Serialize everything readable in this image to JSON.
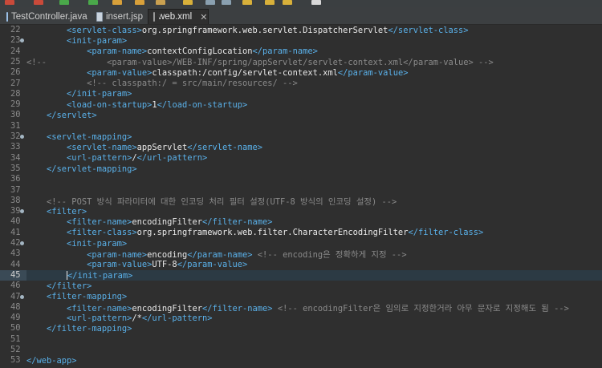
{
  "toolbar": {
    "label": "Eclipse toolbar"
  },
  "tabs": [
    {
      "label": "TestController.java",
      "type": "java"
    },
    {
      "label": "insert.jsp",
      "type": "jsp"
    },
    {
      "label": "web.xml",
      "type": "xml",
      "active": true,
      "close": "✕"
    }
  ],
  "editor": {
    "current_line": 45,
    "lines": [
      {
        "n": "22",
        "fold": false,
        "segs": [
          [
            "x",
            "        "
          ],
          [
            "t",
            "<servlet-class>"
          ],
          [
            "x",
            "org.springframework.web.servlet.DispatcherServlet"
          ],
          [
            "t",
            "</servlet-class>"
          ]
        ]
      },
      {
        "n": "23",
        "fold": true,
        "segs": [
          [
            "x",
            "        "
          ],
          [
            "t",
            "<init-param>"
          ]
        ]
      },
      {
        "n": "24",
        "fold": false,
        "segs": [
          [
            "x",
            "            "
          ],
          [
            "t",
            "<param-name>"
          ],
          [
            "x",
            "contextConfigLocation"
          ],
          [
            "t",
            "</param-name>"
          ]
        ]
      },
      {
        "n": "25",
        "fold": false,
        "segs": [
          [
            "c",
            "<!--            <param-value>/WEB-INF/spring/appServlet/servlet-context.xml</param-value> -->"
          ]
        ]
      },
      {
        "n": "26",
        "fold": false,
        "segs": [
          [
            "x",
            "            "
          ],
          [
            "t",
            "<param-value>"
          ],
          [
            "x",
            "classpath:/config/servlet-context.xml"
          ],
          [
            "t",
            "</param-value>"
          ]
        ]
      },
      {
        "n": "27",
        "fold": false,
        "segs": [
          [
            "x",
            "            "
          ],
          [
            "c",
            "<!-- classpath:/ = src/main/resources/ -->"
          ]
        ]
      },
      {
        "n": "28",
        "fold": false,
        "segs": [
          [
            "x",
            "        "
          ],
          [
            "t",
            "</init-param>"
          ]
        ]
      },
      {
        "n": "29",
        "fold": false,
        "segs": [
          [
            "x",
            "        "
          ],
          [
            "t",
            "<load-on-startup>"
          ],
          [
            "x",
            "1"
          ],
          [
            "t",
            "</load-on-startup>"
          ]
        ]
      },
      {
        "n": "30",
        "fold": false,
        "segs": [
          [
            "x",
            "    "
          ],
          [
            "t",
            "</servlet>"
          ]
        ]
      },
      {
        "n": "31",
        "fold": false,
        "segs": []
      },
      {
        "n": "32",
        "fold": true,
        "segs": [
          [
            "x",
            "    "
          ],
          [
            "t",
            "<servlet-mapping>"
          ]
        ]
      },
      {
        "n": "33",
        "fold": false,
        "segs": [
          [
            "x",
            "        "
          ],
          [
            "t",
            "<servlet-name>"
          ],
          [
            "x",
            "appServlet"
          ],
          [
            "t",
            "</servlet-name>"
          ]
        ]
      },
      {
        "n": "34",
        "fold": false,
        "segs": [
          [
            "x",
            "        "
          ],
          [
            "t",
            "<url-pattern>"
          ],
          [
            "x",
            "/"
          ],
          [
            "t",
            "</url-pattern>"
          ]
        ]
      },
      {
        "n": "35",
        "fold": false,
        "segs": [
          [
            "x",
            "    "
          ],
          [
            "t",
            "</servlet-mapping>"
          ]
        ]
      },
      {
        "n": "36",
        "fold": false,
        "segs": []
      },
      {
        "n": "37",
        "fold": false,
        "segs": []
      },
      {
        "n": "38",
        "fold": false,
        "segs": [
          [
            "x",
            "    "
          ],
          [
            "c",
            "<!-- POST 방식 파라미터에 대한 인코딩 처리 필터 설정(UTF-8 방식의 인코딩 설정) -->"
          ]
        ]
      },
      {
        "n": "39",
        "fold": true,
        "segs": [
          [
            "x",
            "    "
          ],
          [
            "t",
            "<filter>"
          ]
        ]
      },
      {
        "n": "40",
        "fold": false,
        "segs": [
          [
            "x",
            "        "
          ],
          [
            "t",
            "<filter-name>"
          ],
          [
            "x",
            "encodingFilter"
          ],
          [
            "t",
            "</filter-name>"
          ]
        ]
      },
      {
        "n": "41",
        "fold": false,
        "segs": [
          [
            "x",
            "        "
          ],
          [
            "t",
            "<filter-class>"
          ],
          [
            "x",
            "org.springframework.web.filter.CharacterEncodingFilter"
          ],
          [
            "t",
            "</filter-class>"
          ]
        ]
      },
      {
        "n": "42",
        "fold": true,
        "segs": [
          [
            "x",
            "        "
          ],
          [
            "t",
            "<init-param>"
          ]
        ]
      },
      {
        "n": "43",
        "fold": false,
        "segs": [
          [
            "x",
            "            "
          ],
          [
            "t",
            "<param-name>"
          ],
          [
            "x",
            "encoding"
          ],
          [
            "t",
            "</param-name>"
          ],
          [
            "x",
            " "
          ],
          [
            "c",
            "<!-- encoding은 정확하게 지정 -->"
          ]
        ]
      },
      {
        "n": "44",
        "fold": false,
        "segs": [
          [
            "x",
            "            "
          ],
          [
            "t",
            "<param-value>"
          ],
          [
            "x",
            "UTF-8"
          ],
          [
            "t",
            "</param-value>"
          ]
        ]
      },
      {
        "n": "45",
        "fold": false,
        "segs": [
          [
            "x",
            "        "
          ],
          [
            "t",
            "</init-param>"
          ]
        ]
      },
      {
        "n": "46",
        "fold": false,
        "segs": [
          [
            "x",
            "    "
          ],
          [
            "t",
            "</filter>"
          ]
        ]
      },
      {
        "n": "47",
        "fold": true,
        "segs": [
          [
            "x",
            "    "
          ],
          [
            "t",
            "<filter-mapping>"
          ]
        ]
      },
      {
        "n": "48",
        "fold": false,
        "segs": [
          [
            "x",
            "        "
          ],
          [
            "t",
            "<filter-name>"
          ],
          [
            "x",
            "encodingFilter"
          ],
          [
            "t",
            "</filter-name>"
          ],
          [
            "x",
            " "
          ],
          [
            "c",
            "<!-- encodingFilter은 임의로 지정한거라 아무 문자로 지정해도 됨 -->"
          ]
        ]
      },
      {
        "n": "49",
        "fold": false,
        "segs": [
          [
            "x",
            "        "
          ],
          [
            "t",
            "<url-pattern>"
          ],
          [
            "x",
            "/*"
          ],
          [
            "t",
            "</url-pattern>"
          ]
        ]
      },
      {
        "n": "50",
        "fold": false,
        "segs": [
          [
            "x",
            "    "
          ],
          [
            "t",
            "</filter-mapping>"
          ]
        ]
      },
      {
        "n": "51",
        "fold": false,
        "segs": []
      },
      {
        "n": "52",
        "fold": false,
        "segs": []
      },
      {
        "n": "53",
        "fold": false,
        "segs": [
          [
            "t",
            "</web-app>"
          ]
        ]
      }
    ]
  },
  "colors": {
    "tag": "#5ab1ea",
    "text": "#e8e8e8",
    "comment": "#8a8a8a",
    "background": "#2f2f2f"
  }
}
